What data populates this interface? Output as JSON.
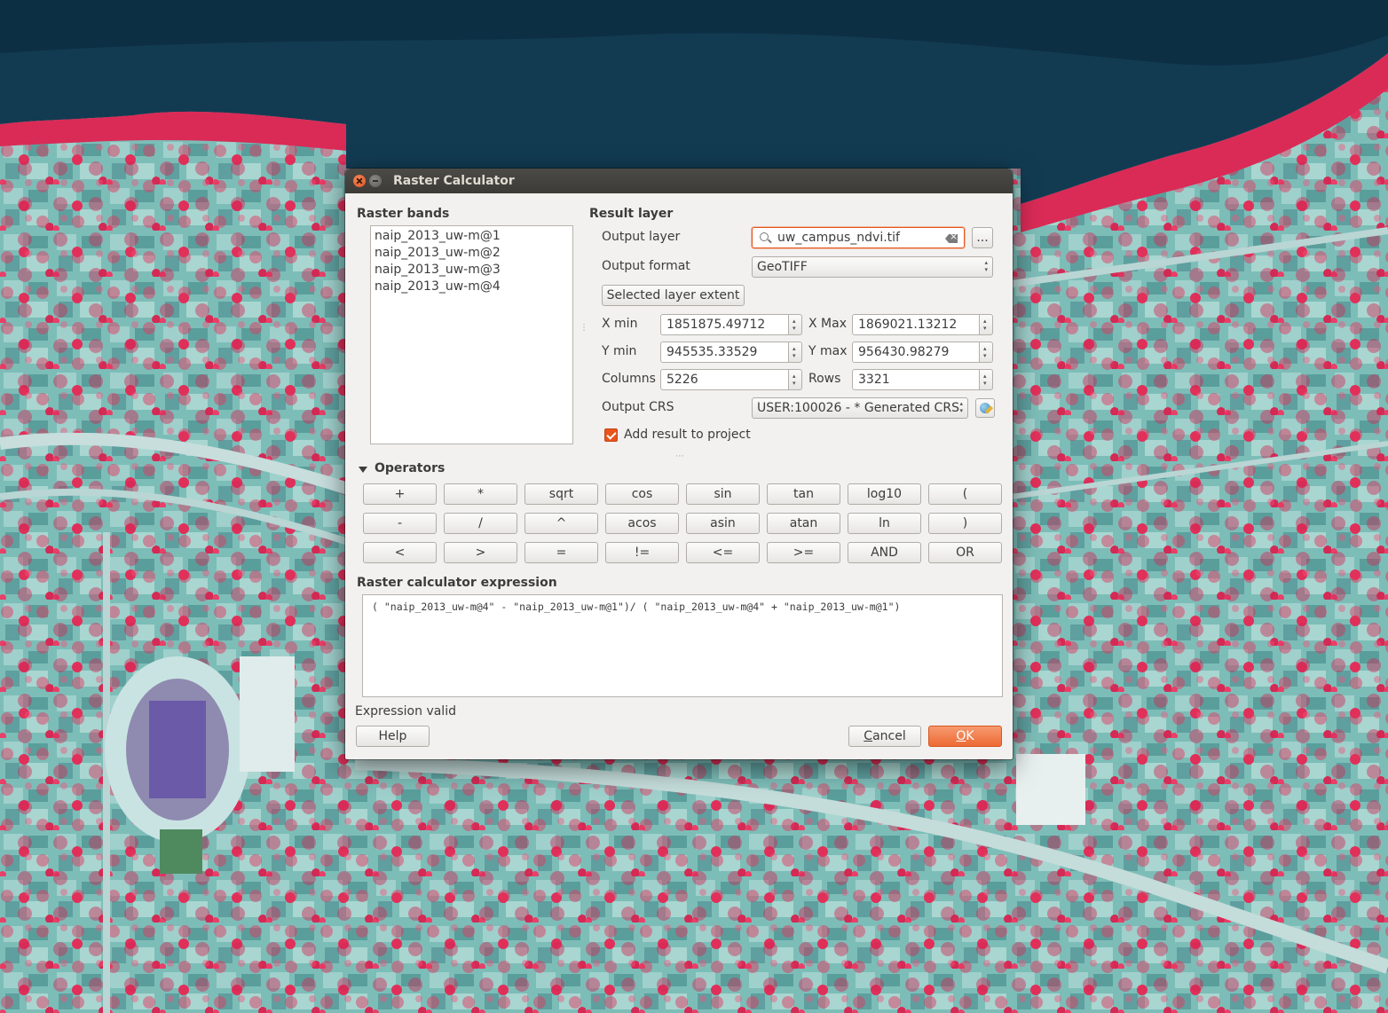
{
  "window": {
    "title": "Raster Calculator"
  },
  "raster_bands": {
    "label": "Raster bands",
    "items": [
      "naip_2013_uw-m@1",
      "naip_2013_uw-m@2",
      "naip_2013_uw-m@3",
      "naip_2013_uw-m@4"
    ]
  },
  "result_layer": {
    "label": "Result layer",
    "output_layer_label": "Output layer",
    "output_layer_value": "uw_campus_ndvi.tif",
    "browse_label": "...",
    "output_format_label": "Output format",
    "output_format_value": "GeoTIFF",
    "selected_extent_label": "Selected layer extent",
    "xmin_label": "X min",
    "xmin_value": "1851875.49712",
    "xmax_label": "X Max",
    "xmax_value": "1869021.13212",
    "ymin_label": "Y min",
    "ymin_value": "945535.33529",
    "ymax_label": "Y max",
    "ymax_value": "956430.98279",
    "columns_label": "Columns",
    "columns_value": "5226",
    "rows_label": "Rows",
    "rows_value": "3321",
    "crs_label": "Output CRS",
    "crs_value": "USER:100026 -  * Generated CRS",
    "add_to_project_label": "Add result to project",
    "add_to_project_checked": true
  },
  "operators": {
    "label": "Operators",
    "row1": [
      "+",
      "*",
      "sqrt",
      "cos",
      "sin",
      "tan",
      "log10",
      "("
    ],
    "row2": [
      "-",
      "/",
      "^",
      "acos",
      "asin",
      "atan",
      "ln",
      ")"
    ],
    "row3": [
      "<",
      ">",
      "=",
      "!=",
      "<=",
      ">=",
      "AND",
      "OR"
    ]
  },
  "expression": {
    "label": "Raster calculator expression",
    "value": "( \"naip_2013_uw-m@4\" - \"naip_2013_uw-m@1\")/ ( \"naip_2013_uw-m@4\" + \"naip_2013_uw-m@1\")",
    "status": "Expression valid"
  },
  "buttons": {
    "help": "Help",
    "cancel_prefix": "C",
    "cancel_rest": "ancel",
    "ok_prefix": "O",
    "ok_rest": "K"
  },
  "colors": {
    "accent": "#e9541b",
    "vegetation": "#e0305a",
    "urban": "#6fb6b4",
    "water": "#123b52"
  }
}
